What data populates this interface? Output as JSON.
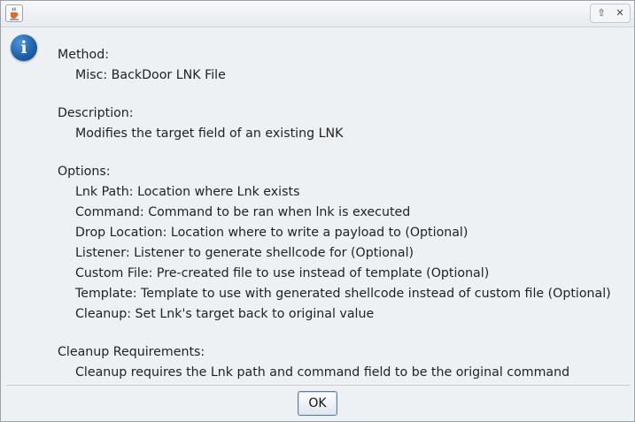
{
  "dialog": {
    "sections": [
      {
        "heading": "Method:",
        "lines": [
          "Misc: BackDoor LNK File"
        ]
      },
      {
        "heading": "Description:",
        "lines": [
          "Modifies the target field of an existing LNK"
        ]
      },
      {
        "heading": "Options:",
        "lines": [
          "Lnk Path: Location where Lnk exists",
          "Command: Command to be ran when lnk is executed",
          "Drop Location: Location where to write a payload to (Optional)",
          "Listener: Listener to generate shellcode for (Optional)",
          "Custom File: Pre-created file to use instead of template (Optional)",
          "Template: Template to use with generated shellcode instead of custom file (Optional)",
          "Cleanup: Set Lnk's target back to original value"
        ]
      },
      {
        "heading": "Cleanup Requirements:",
        "lines": [
          "Cleanup requires the Lnk path and command field to be the original command"
        ]
      }
    ],
    "ok_label": "OK"
  },
  "titlebar": {
    "max_glyph": "⇧",
    "close_glyph": "✕"
  },
  "icons": {
    "app": "java-cup-icon",
    "info": "info-icon",
    "info_glyph": "i"
  }
}
